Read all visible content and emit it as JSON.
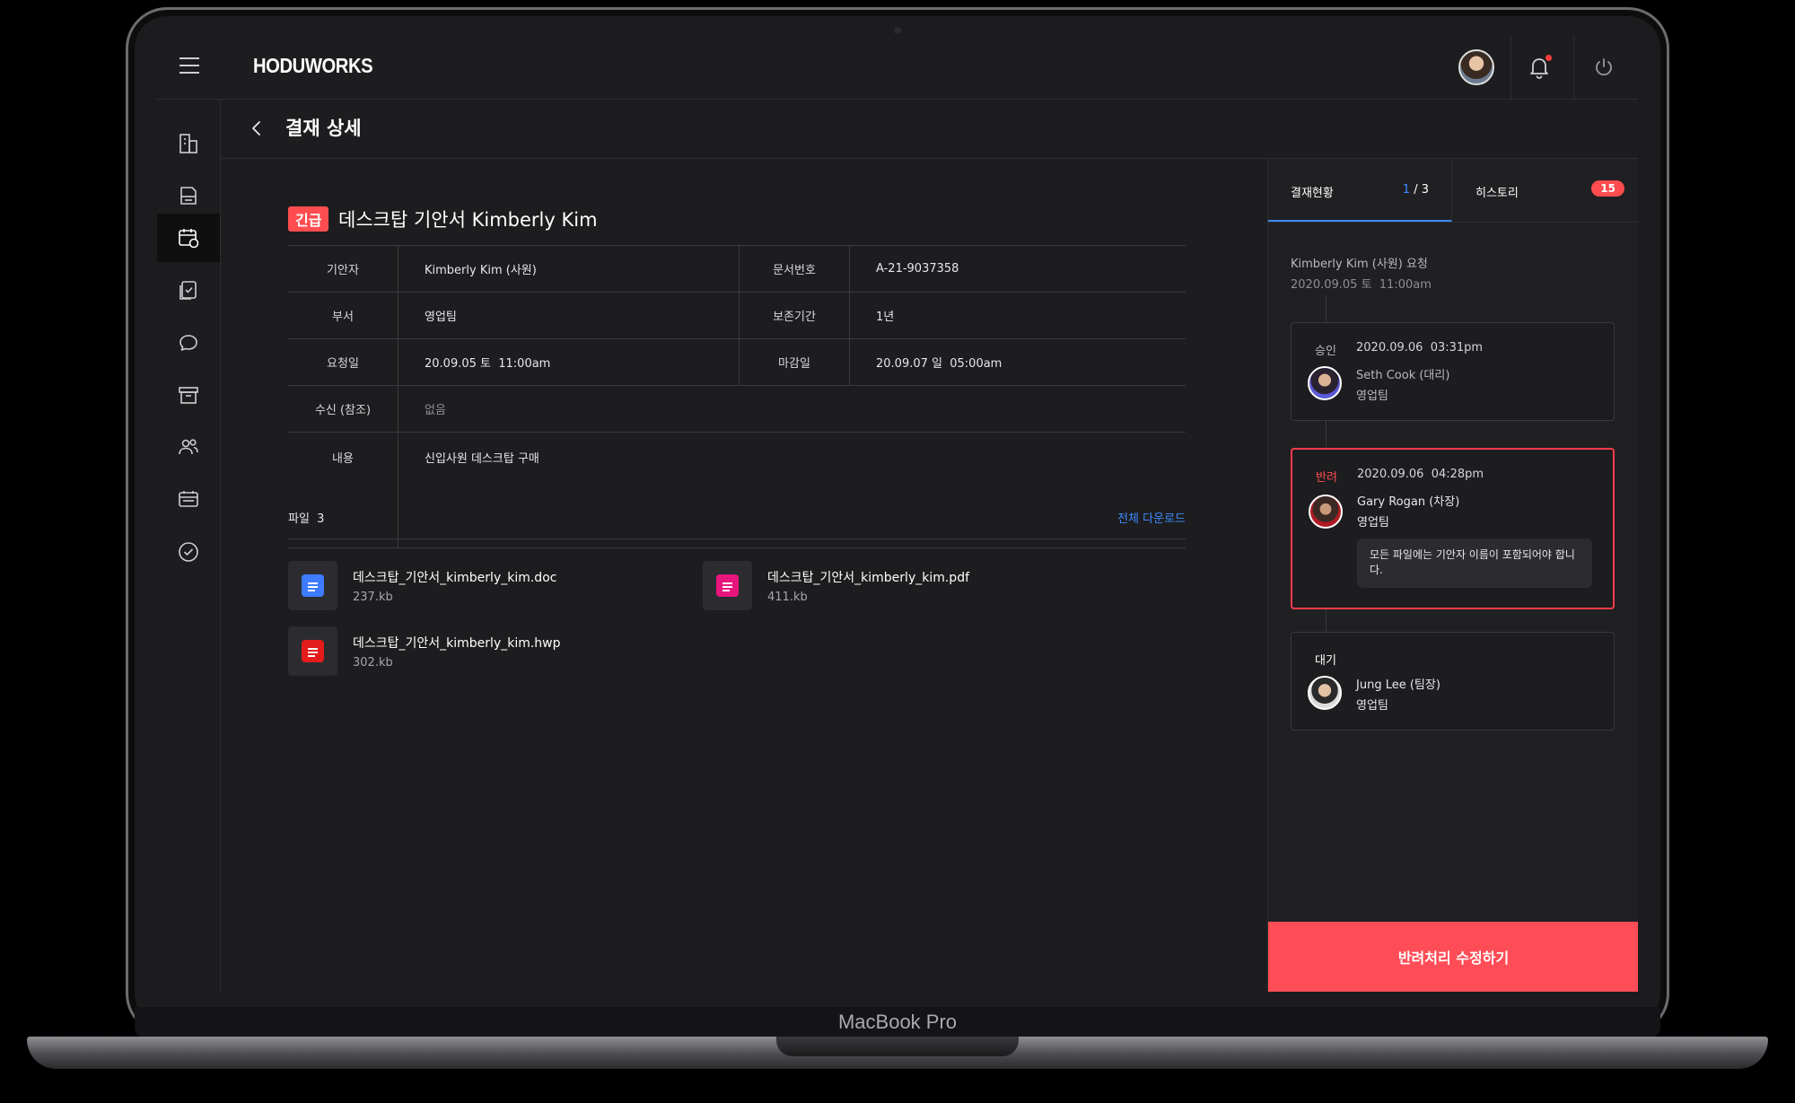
{
  "device": {
    "label": "MacBook Pro"
  },
  "app": {
    "brand": "HODUWORKS"
  },
  "page": {
    "title": "결재 상세"
  },
  "document": {
    "urgent_badge": "긴급",
    "title": "데스크탑 기안서 Kimberly Kim",
    "fields": {
      "drafter_label": "기안자",
      "drafter": "Kimberly Kim (사원)",
      "doc_no_label": "문서번호",
      "doc_no": "A-21-9037358",
      "dept_label": "부서",
      "dept": "영업팀",
      "retention_label": "보존기간",
      "retention": "1년",
      "request_date_label": "요청일",
      "request_date": "20.09.05 토  11:00am",
      "deadline_label": "마감일",
      "deadline": "20.09.07 일  05:00am",
      "cc_label": "수신 (참조)",
      "cc": "없음",
      "content_label": "내용",
      "content": "신입사원 데스크탑 구매"
    }
  },
  "files": {
    "label": "파일  3",
    "download_all": "전체 다운로드",
    "items": [
      {
        "name": "데스크탑_기안서_kimberly_kim.doc",
        "size": "237.kb",
        "color": "#3d7bff"
      },
      {
        "name": "데스크탑_기안서_kimberly_kim.pdf",
        "size": "411.kb",
        "color": "#e8157c"
      },
      {
        "name": "데스크탑_기안서_kimberly_kim.hwp",
        "size": "302.kb",
        "color": "#e41b1b"
      }
    ]
  },
  "panel": {
    "tab_status": "결재현황",
    "tab_status_current": "1",
    "tab_status_total": " / 3",
    "tab_history": "히스토리",
    "history_count": "15",
    "request_line": "Kimberly Kim (사원) 요청",
    "request_time": "2020.09.05 토  11:00am",
    "steps": [
      {
        "status": "승인",
        "time": "2020.09.06  03:31pm",
        "name": "Seth Cook (대리)",
        "team": "영업팀"
      },
      {
        "status": "반려",
        "time": "2020.09.06  04:28pm",
        "name": "Gary Rogan (차장)",
        "team": "영업팀",
        "comment": "모든 파일에는 기안자 이름이 포함되어야 합니다."
      },
      {
        "status": "대기",
        "name": "Jung Lee (팀장)",
        "team": "영업팀"
      }
    ],
    "action_button": "반려처리 수정하기"
  },
  "colors": {
    "accent": "#3d8bff",
    "danger": "#ff4d4f",
    "background": "#1d1d1f"
  }
}
